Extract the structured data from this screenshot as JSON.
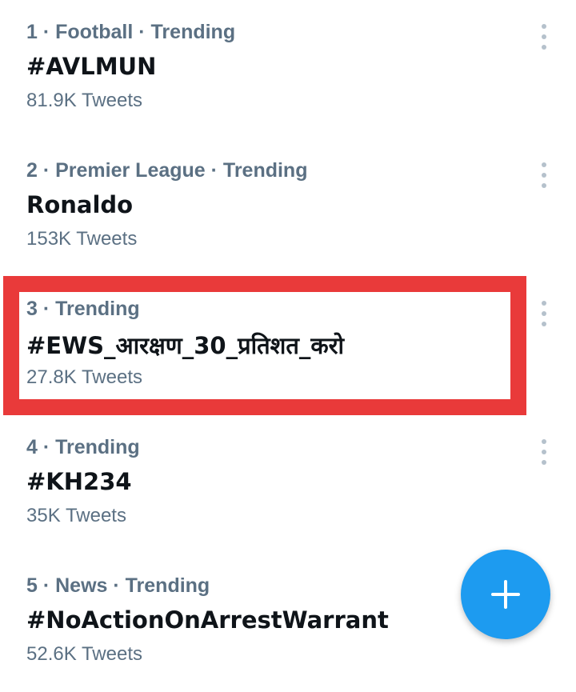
{
  "trends": [
    {
      "meta": "1 · Football · Trending",
      "title": "#AVLMUN",
      "count": "81.9K Tweets"
    },
    {
      "meta": "2 · Premier League · Trending",
      "title": "Ronaldo",
      "count": "153K Tweets"
    },
    {
      "meta": "3 · Trending",
      "title": "#EWS_आरक्षण_30_प्रतिशत_करो",
      "count": "27.8K Tweets"
    },
    {
      "meta": "4 · Trending",
      "title": "#KH234",
      "count": "35K Tweets"
    },
    {
      "meta": "5 · News · Trending",
      "title": "#NoActionOnArrestWarrant",
      "count": "52.6K Tweets"
    }
  ],
  "fab": {
    "icon": "plus-icon"
  },
  "colors": {
    "accent": "#1d9bf0",
    "highlight": "#e93a3a",
    "meta": "#5b7083",
    "title": "#0f1419"
  }
}
